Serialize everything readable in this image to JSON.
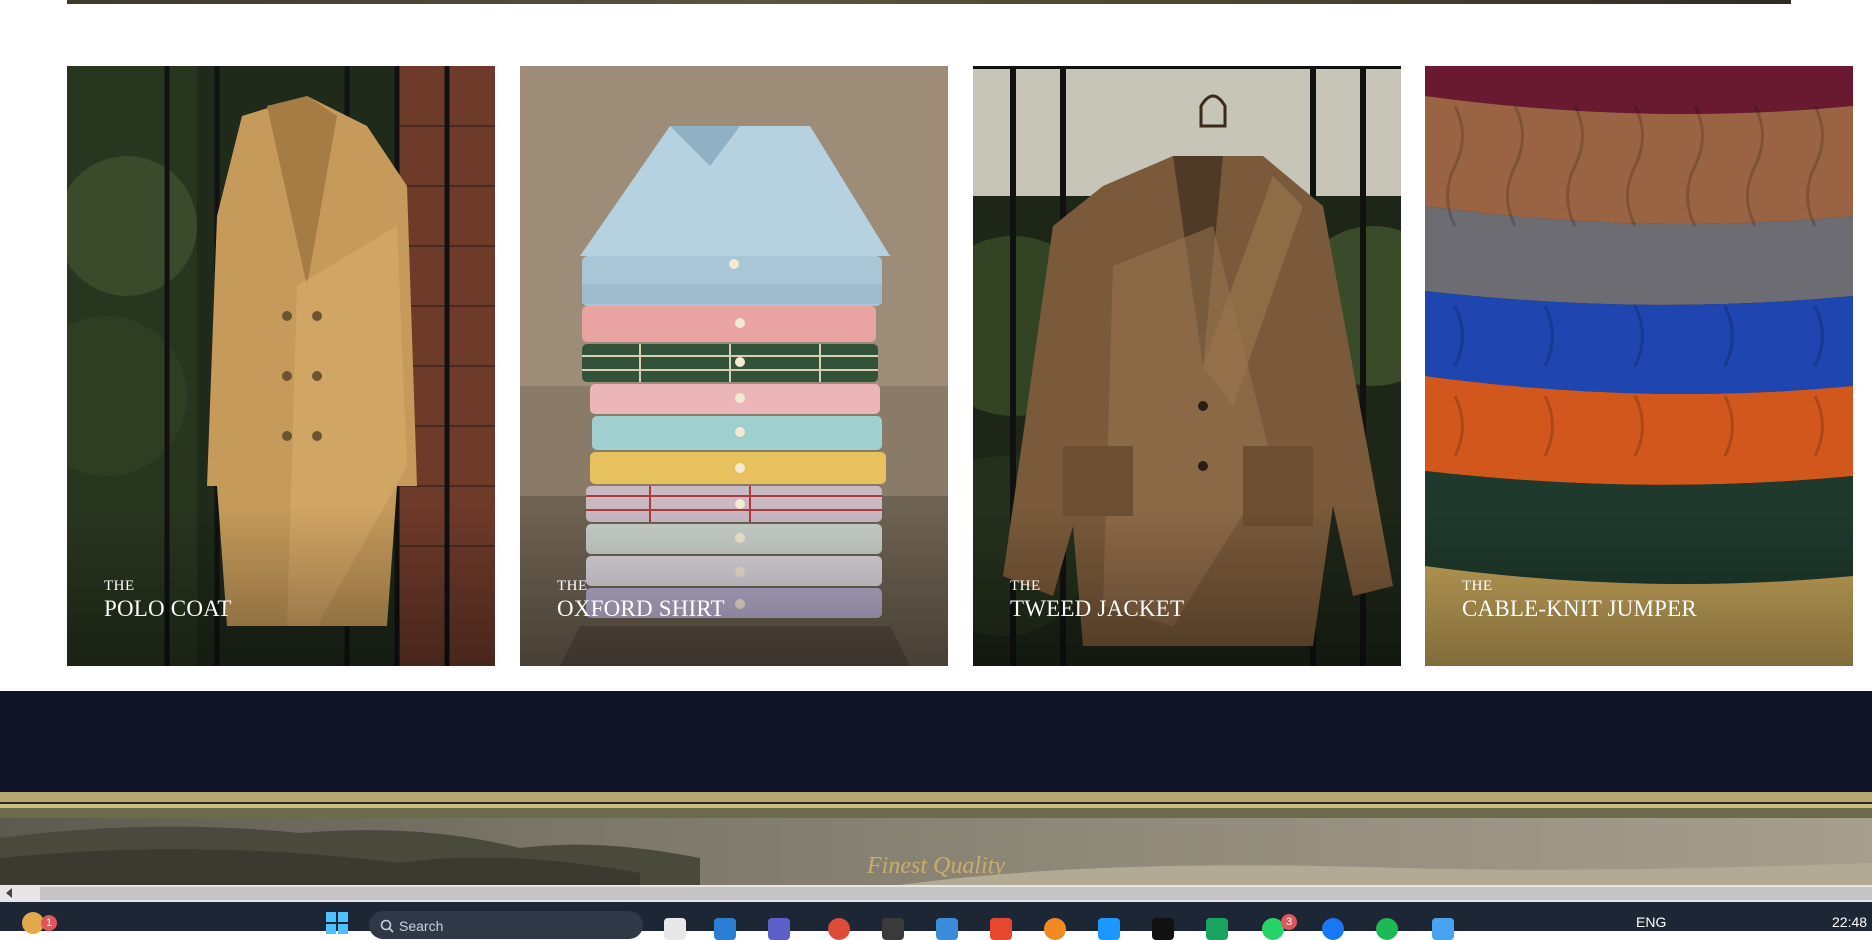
{
  "cards": [
    {
      "eyebrow": "THE",
      "title": "POLO COAT",
      "image": "camel-overcoat-on-iron-gate"
    },
    {
      "eyebrow": "THE",
      "title": "OXFORD SHIRT",
      "image": "stack-of-folded-oxford-shirts"
    },
    {
      "eyebrow": "THE",
      "title": "TWEED JACKET",
      "image": "tweed-jacket-on-iron-gate"
    },
    {
      "eyebrow": "THE",
      "title": "CABLE-KNIT JUMPER",
      "image": "stack-of-cable-knit-jumpers"
    }
  ],
  "footer": {
    "tagline": "Finest Quality"
  },
  "colors": {
    "navy": "#101628",
    "gold": "#b6a66f",
    "tagline": "#c9ad6a"
  },
  "taskbar": {
    "search_placeholder": "Search",
    "language": "ENG",
    "time": "22:48",
    "badges": {
      "widgets": "1",
      "whatsapp": "3"
    },
    "icons": [
      "windows-start-icon",
      "search-icon",
      "file-explorer-icon",
      "notepad-icon",
      "vscode-icon",
      "teams-icon",
      "chrome-icon",
      "terminal-icon",
      "copilot-icon",
      "office-icon",
      "firefox-icon",
      "prime-video-icon",
      "app-icon",
      "google-drive-icon",
      "whatsapp-icon",
      "messenger-icon",
      "spotify-icon",
      "calendar-icon"
    ]
  }
}
